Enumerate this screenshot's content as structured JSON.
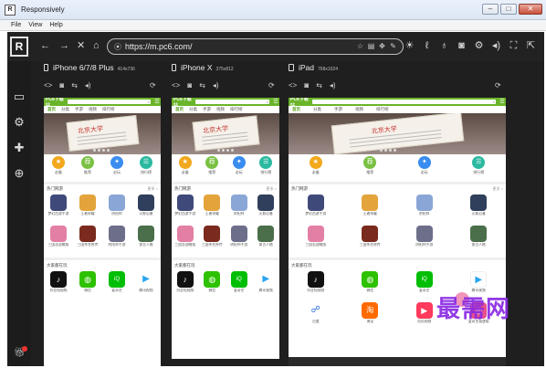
{
  "window": {
    "title": "Responsively",
    "controls": [
      "–",
      "□",
      "✕"
    ]
  },
  "menu": [
    "File",
    "View",
    "Help"
  ],
  "toolbar": {
    "logo": "R",
    "url": "https://m.pc6.com/",
    "url_icons": [
      "☆",
      "▤",
      "✥",
      "✎"
    ],
    "tools": [
      "☀",
      "ℓ",
      "♁",
      "◙",
      "⚙",
      "◂)",
      "⛶",
      "⇱",
      "⊕"
    ]
  },
  "sidebar": {
    "icons": [
      "devices-icon",
      "settings-icon",
      "extensions-icon",
      "network-icon",
      "gift-icon"
    ]
  },
  "devices": [
    {
      "name": "iPhone 6/7/8 Plus",
      "dimension": "414x736",
      "tools": [
        "<>",
        "◙",
        "⇆",
        "◂)"
      ],
      "refresh": "⟳"
    },
    {
      "name": "iPhone X",
      "dimension": "375x812",
      "tools": [
        "<>",
        "◙",
        "⇆",
        "◂)"
      ],
      "refresh": "⟳"
    },
    {
      "name": "iPad",
      "dimension": "768x1024",
      "tools": [
        "<>",
        "◙",
        "⇆",
        "◂)"
      ],
      "refresh": "⟳"
    }
  ],
  "site": {
    "logo": "PC6下载站",
    "tabs": [
      "首页",
      "分类",
      "手游",
      "视频",
      "排行榜"
    ],
    "cert_title": "北京大学",
    "categories": [
      {
        "label": "必备",
        "color": "#f2a81e",
        "glyph": "★"
      },
      {
        "label": "推荐",
        "color": "#7ac143",
        "glyph": "荐"
      },
      {
        "label": "必玩",
        "color": "#3a8df0",
        "glyph": "✦"
      },
      {
        "label": "排行榜",
        "color": "#2bb9a0",
        "glyph": "☰"
      }
    ],
    "hot_section": "热门网游",
    "more": "更多 >",
    "hot_games": [
      {
        "label": "梦幻西游手游",
        "color": "#3f4a7a"
      },
      {
        "label": "王者荣耀",
        "color": "#e3a43c"
      },
      {
        "label": "阴阳师",
        "color": "#8aa6d6"
      },
      {
        "label": "火影忍者",
        "color": "#2f3f5c"
      },
      {
        "label": "三国志战略版",
        "color": "#e37fa5"
      },
      {
        "label": "三国杀名将传",
        "color": "#7a2a1e"
      },
      {
        "label": "阴阳师手游",
        "color": "#6d6f8a"
      },
      {
        "label": "第五人格",
        "color": "#4a6f4a"
      }
    ],
    "apps_section": "大家都在玩",
    "apps": [
      {
        "label": "抖音短视频",
        "color": "#111111",
        "glyph": "♪"
      },
      {
        "label": "微信",
        "color": "#2dc100",
        "glyph": "◍"
      },
      {
        "label": "爱奇艺",
        "color": "#00be06",
        "glyph": "iQ"
      },
      {
        "label": "腾讯视频",
        "color": "#ffffff",
        "glyph": "▶"
      }
    ],
    "more_apps": [
      {
        "label": "百度",
        "color": "#2f6ddf",
        "glyph": "☍"
      },
      {
        "label": "淘宝",
        "color": "#ff6a00",
        "glyph": "淘"
      },
      {
        "label": "西瓜视频",
        "color": "#ff3a5c",
        "glyph": "▶"
      },
      {
        "label": "爱奇艺极速版",
        "color": "#e8508a",
        "glyph": "◎"
      }
    ]
  },
  "watermark": "最需网"
}
